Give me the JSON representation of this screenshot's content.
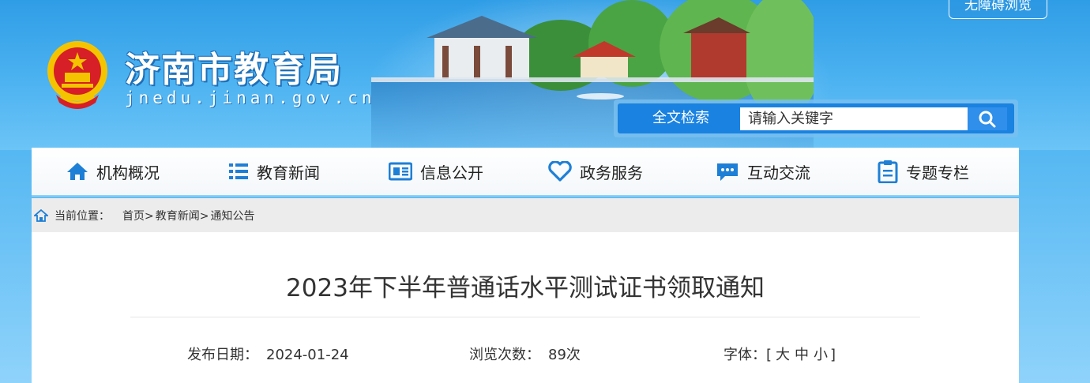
{
  "header": {
    "accessible_label": "无障碍浏览",
    "site_name": "济南市教育局",
    "site_domain": "jnedu.jinan.gov.cn",
    "search": {
      "label": "全文检索",
      "placeholder": "请输入关键字"
    }
  },
  "nav": {
    "items": [
      {
        "label": "机构概况",
        "icon": "home-icon"
      },
      {
        "label": "教育新闻",
        "icon": "list-icon"
      },
      {
        "label": "信息公开",
        "icon": "newspaper-icon"
      },
      {
        "label": "政务服务",
        "icon": "heart-icon"
      },
      {
        "label": "互动交流",
        "icon": "chat-icon"
      },
      {
        "label": "专题专栏",
        "icon": "clipboard-icon"
      }
    ]
  },
  "breadcrumb": {
    "label": "当前位置：",
    "items": [
      "首页>",
      "教育新闻>",
      "通知公告"
    ]
  },
  "article": {
    "title": "2023年下半年普通话水平测试证书领取通知",
    "publish_label": "发布日期：",
    "publish_date": "2024-01-24",
    "views_label": "浏览次数：",
    "views_value": "89次",
    "font_label": "字体：",
    "font_open": "[",
    "font_large": "大",
    "font_medium": "中",
    "font_small": "小",
    "font_close": "]"
  },
  "colors": {
    "accent": "#1a82e0",
    "nav_icon": "#1e7fd6",
    "emblem_red": "#d61f26",
    "emblem_gold": "#f5c400"
  }
}
